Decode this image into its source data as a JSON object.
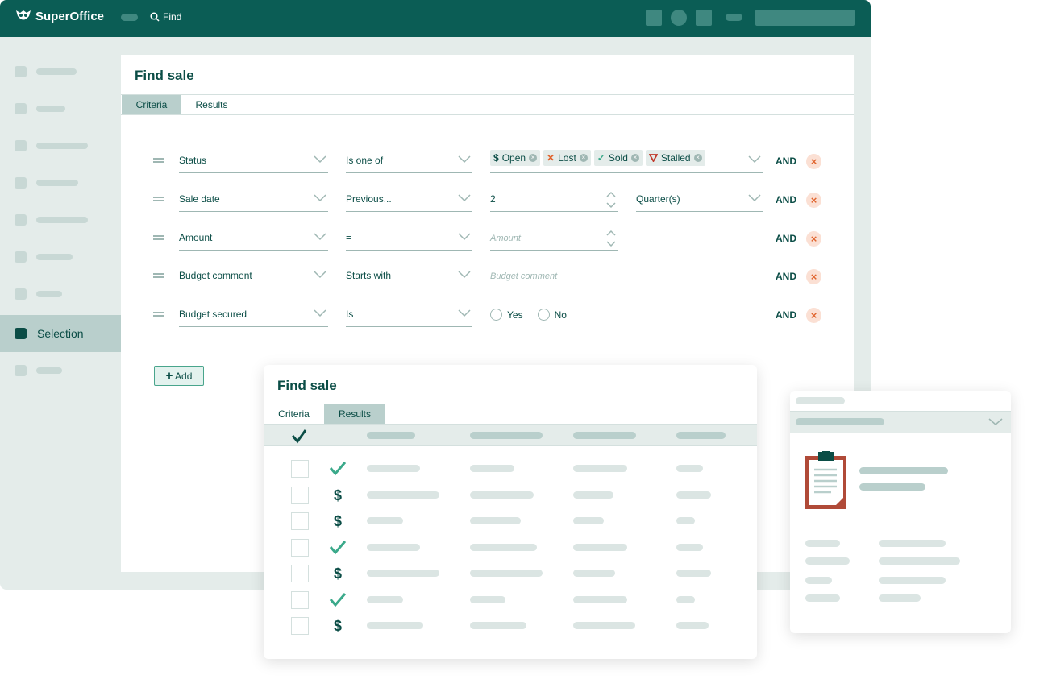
{
  "app": {
    "brand": "SuperOffice",
    "find_label": "Find"
  },
  "sidebar": {
    "active_label": "Selection"
  },
  "criteria_panel": {
    "title": "Find sale",
    "tabs": [
      "Criteria",
      "Results"
    ],
    "active_tab": "Criteria",
    "rows": [
      {
        "field": "Status",
        "operator": "Is one of",
        "and_label": "AND",
        "tags": [
          {
            "icon": "dollar-icon",
            "label": "Open"
          },
          {
            "icon": "cross-icon",
            "label": "Lost"
          },
          {
            "icon": "check-icon",
            "label": "Sold"
          },
          {
            "icon": "stalled-icon",
            "label": "Stalled"
          }
        ]
      },
      {
        "field": "Sale date",
        "operator": "Previous...",
        "value": "2",
        "unit": "Quarter(s)",
        "and_label": "AND"
      },
      {
        "field": "Amount",
        "operator": "=",
        "placeholder": "Amount",
        "and_label": "AND"
      },
      {
        "field": "Budget comment",
        "operator": "Starts with",
        "placeholder": "Budget comment",
        "and_label": "AND"
      },
      {
        "field": "Budget secured",
        "operator": "Is",
        "options": [
          "Yes",
          "No"
        ],
        "and_label": "AND"
      }
    ],
    "add_label": "Add"
  },
  "results_panel": {
    "title": "Find sale",
    "tabs": [
      "Criteria",
      "Results"
    ],
    "active_tab": "Results",
    "row_icons": [
      "check-icon",
      "dollar-icon",
      "dollar-icon",
      "check-icon",
      "dollar-icon",
      "check-icon",
      "dollar-icon"
    ]
  },
  "detail_panel": {
    "icon": "clipboard-icon"
  },
  "colors": {
    "brand": "#0b5d55",
    "accent_green": "#3aa98a",
    "danger": "#e0642e",
    "stalled": "#c0392b"
  }
}
